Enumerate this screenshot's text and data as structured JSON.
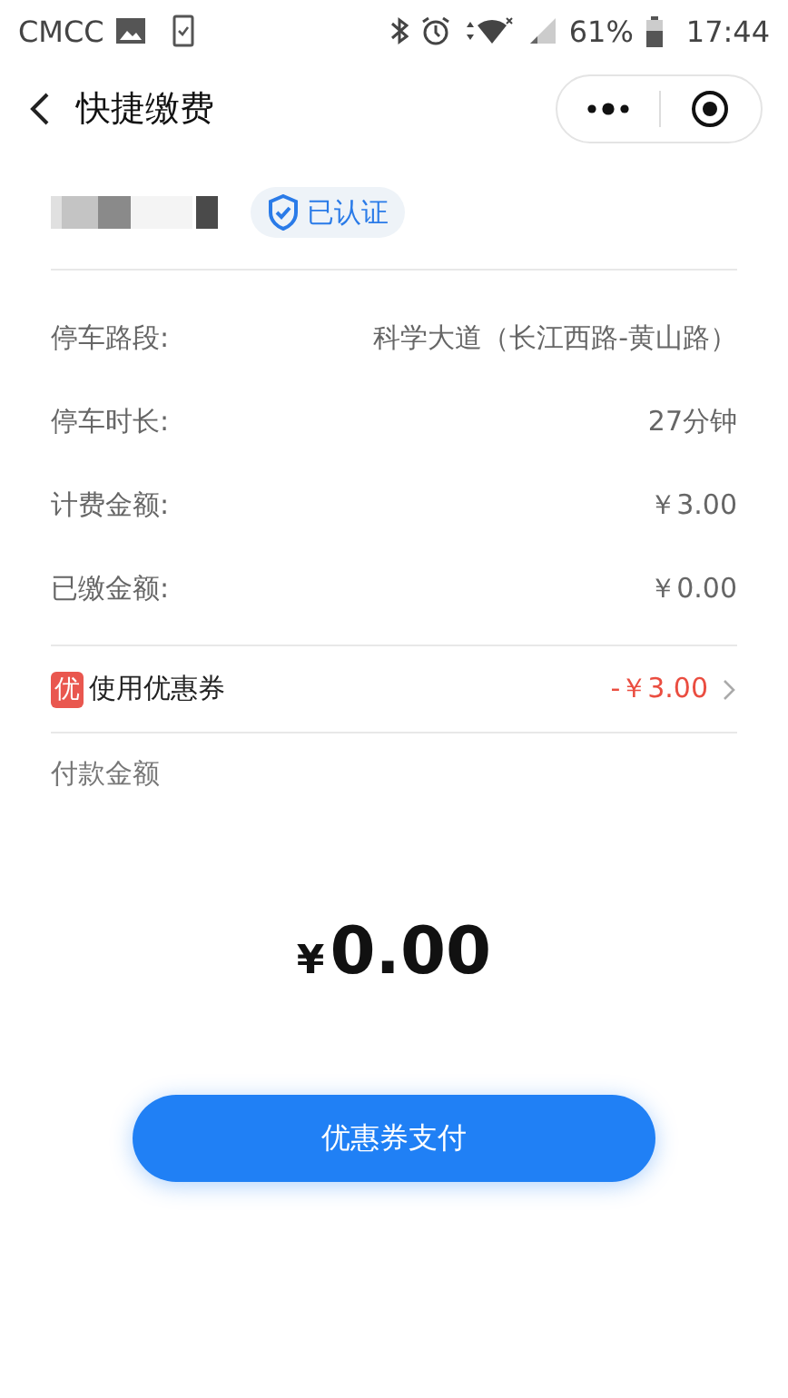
{
  "status_bar": {
    "carrier": "CMCC",
    "battery": "61%",
    "time": "17:44"
  },
  "nav": {
    "title": "快捷缴费"
  },
  "vehicle": {
    "badge": "已认证"
  },
  "details": [
    {
      "label": "停车路段:",
      "value": "科学大道（长江西路-黄山路）"
    },
    {
      "label": "停车时长:",
      "value": "27分钟"
    },
    {
      "label": "计费金额:",
      "value": "￥3.00"
    },
    {
      "label": "已缴金额:",
      "value": "￥0.00"
    }
  ],
  "coupon": {
    "tag": "优",
    "label": "使用优惠券",
    "amount": "-￥3.00"
  },
  "payment": {
    "label": "付款金额",
    "currency": "¥",
    "amount": "0.00"
  },
  "pay_button": "优惠券支付"
}
